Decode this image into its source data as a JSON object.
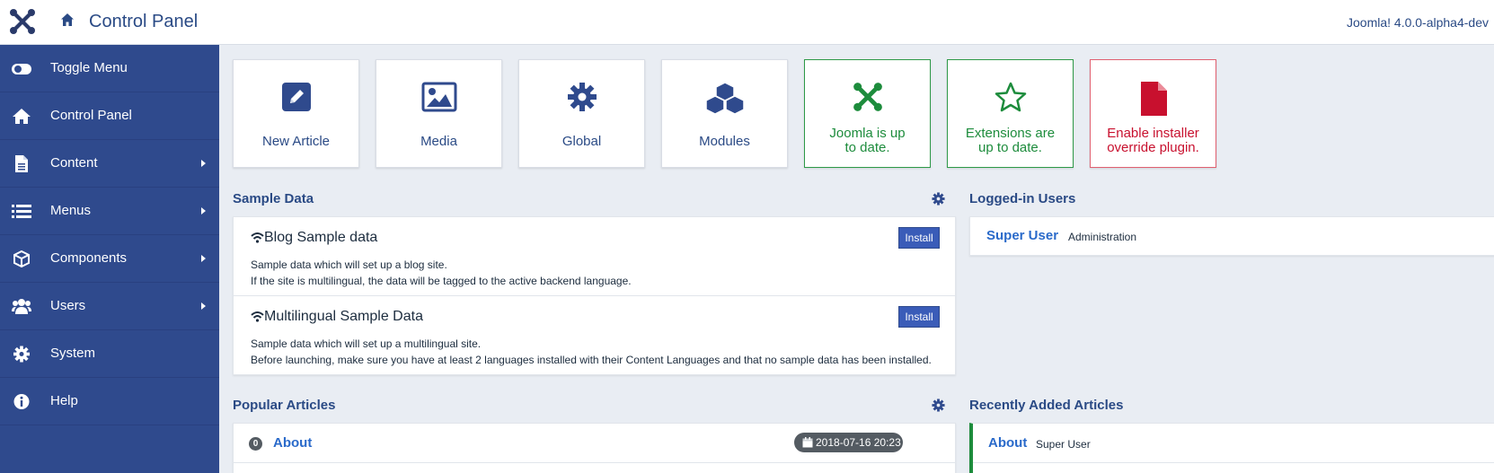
{
  "header": {
    "title": "Control Panel",
    "version": "Joomla! 4.0.0-alpha4-dev"
  },
  "sidebar": {
    "items": [
      {
        "label": "Toggle Menu",
        "icon": "toggle-icon",
        "submenu": false
      },
      {
        "label": "Control Panel",
        "icon": "home-icon",
        "submenu": false
      },
      {
        "label": "Content",
        "icon": "file-icon",
        "submenu": true
      },
      {
        "label": "Menus",
        "icon": "list-icon",
        "submenu": true
      },
      {
        "label": "Components",
        "icon": "cube-icon",
        "submenu": true
      },
      {
        "label": "Users",
        "icon": "users-icon",
        "submenu": true
      },
      {
        "label": "System",
        "icon": "gear-icon",
        "submenu": false
      },
      {
        "label": "Help",
        "icon": "info-icon",
        "submenu": false
      }
    ]
  },
  "quickicons": [
    {
      "label": "New Article",
      "icon": "pencil-icon",
      "status": "default"
    },
    {
      "label": "Media",
      "icon": "image-icon",
      "status": "default"
    },
    {
      "label": "Global",
      "icon": "gear-icon",
      "status": "default"
    },
    {
      "label": "Modules",
      "icon": "cubes-icon",
      "status": "default"
    },
    {
      "label": "Joomla is up to date.",
      "icon": "joomla-icon",
      "status": "success"
    },
    {
      "label": "Extensions are up to date.",
      "icon": "star-icon",
      "status": "success"
    },
    {
      "label": "Enable installer override plugin.",
      "icon": "file-icon",
      "status": "danger"
    }
  ],
  "sample_data": {
    "title": "Sample Data",
    "items": [
      {
        "title": "Blog Sample data",
        "desc1": "Sample data which will set up a blog site.",
        "desc2": "If the site is multilingual, the data will be tagged to the active backend language.",
        "button": "Install"
      },
      {
        "title": "Multilingual Sample Data",
        "desc1": "Sample data which will set up a multilingual site.",
        "desc2": "Before launching, make sure you have at least 2 languages installed with their Content Languages and that no sample data has been installed.",
        "button": "Install"
      }
    ]
  },
  "logged_in": {
    "title": "Logged-in Users",
    "users": [
      {
        "name": "Super User",
        "role": "Administration"
      }
    ]
  },
  "popular": {
    "title": "Popular Articles",
    "items": [
      {
        "hits": "0",
        "title": "About",
        "date": "2018-07-16 20:23"
      }
    ]
  },
  "recent": {
    "title": "Recently Added Articles",
    "items": [
      {
        "title": "About",
        "author": "Super User"
      }
    ]
  },
  "colors": {
    "sidebar": "#2f4a8d",
    "accent": "#2a4a85",
    "success": "#1d8c3c",
    "danger": "#c8102e"
  }
}
